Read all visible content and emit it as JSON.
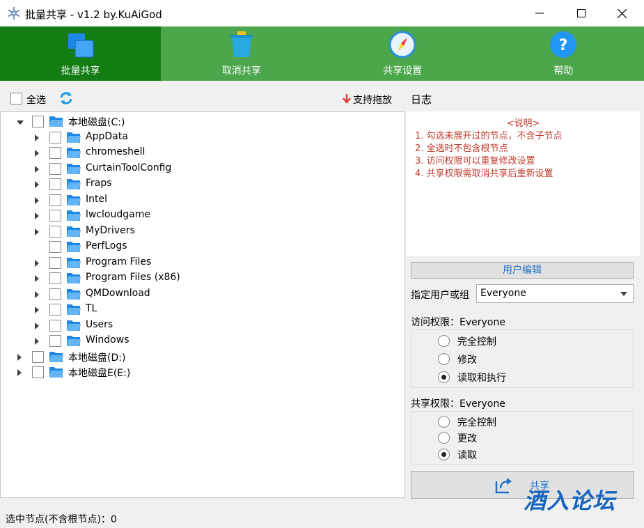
{
  "window": {
    "title": "批量共享 - v1.2 by.KuAiGod",
    "minimize_label": "minimize",
    "maximize_label": "maximize",
    "close_label": "close"
  },
  "toolbar": {
    "items": [
      {
        "label": "批量共享",
        "icon": "share-windows-icon"
      },
      {
        "label": "取消共享",
        "icon": "trash-icon"
      },
      {
        "label": "共享设置",
        "icon": "compass-icon"
      },
      {
        "label": "帮助",
        "icon": "help-icon"
      }
    ],
    "active_color": "#137d13",
    "color": "#4ca64c"
  },
  "left": {
    "select_all_label": "全选",
    "drag_hint": "支持拖放",
    "tree": [
      {
        "label": "本地磁盘(C:)",
        "level": 0,
        "expanded": true
      },
      {
        "label": "AppData",
        "level": 1
      },
      {
        "label": "chromeshell",
        "level": 1
      },
      {
        "label": "CurtainToolConfig",
        "level": 1
      },
      {
        "label": "Fraps",
        "level": 1
      },
      {
        "label": "Intel",
        "level": 1
      },
      {
        "label": "lwcloudgame",
        "level": 1
      },
      {
        "label": "MyDrivers",
        "level": 1
      },
      {
        "label": "PerfLogs",
        "level": 1,
        "no_arrow": true
      },
      {
        "label": "Program Files",
        "level": 1
      },
      {
        "label": "Program Files (x86)",
        "level": 1
      },
      {
        "label": "QMDownload",
        "level": 1
      },
      {
        "label": "TL",
        "level": 1
      },
      {
        "label": "Users",
        "level": 1
      },
      {
        "label": "Windows",
        "level": 1
      },
      {
        "label": "本地磁盘(D:)",
        "level": 0
      },
      {
        "label": "本地磁盘E(E:)",
        "level": 0
      }
    ]
  },
  "right": {
    "log_title": "日志",
    "notes_title": "<说明>",
    "notes": [
      "1. 勾选未展开过的节点，不含子节点",
      "2. 全选时不包含根节点",
      "3. 访问权限可以重复修改设置",
      "4. 共享权限需取消共享后重新设置"
    ],
    "user_edit_button": "用户编辑",
    "user_label": "指定用户或组",
    "user_value": "Everyone",
    "access_title": "访问权限：Everyone",
    "access_options": [
      "完全控制",
      "修改",
      "读取和执行"
    ],
    "access_selected": 2,
    "share_title": "共享权限：Everyone",
    "share_options": [
      "完全控制",
      "更改",
      "读取"
    ],
    "share_selected": 2,
    "share_button": "共享"
  },
  "status": {
    "text": "选中节点(不含根节点)：0"
  },
  "watermark": "酒入论坛"
}
